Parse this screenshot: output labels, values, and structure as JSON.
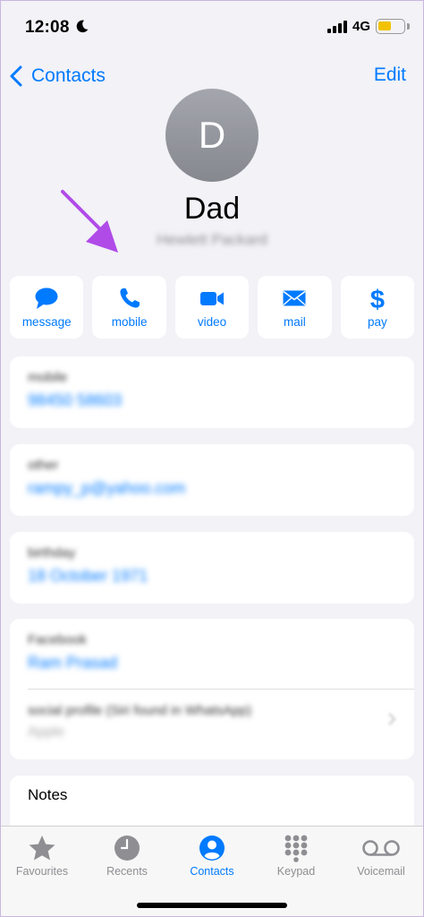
{
  "status_bar": {
    "time": "12:08",
    "network": "4G",
    "battery_level": 0.55
  },
  "nav": {
    "back_label": "Contacts",
    "edit_label": "Edit"
  },
  "contact": {
    "initial": "D",
    "name": "Dad",
    "company": "Hewlett Packard"
  },
  "actions": [
    {
      "label": "message",
      "icon": "message-bubble-icon"
    },
    {
      "label": "mobile",
      "icon": "phone-icon"
    },
    {
      "label": "video",
      "icon": "video-camera-icon"
    },
    {
      "label": "mail",
      "icon": "envelope-icon"
    },
    {
      "label": "pay",
      "icon": "dollar-icon"
    }
  ],
  "fields": {
    "mobile": {
      "label": "mobile",
      "value": "98450 58603"
    },
    "other": {
      "label": "other",
      "value": "rampy_p@yahoo.com"
    },
    "birthday": {
      "label": "birthday",
      "value": "18 October 1971"
    },
    "facebook": {
      "label": "Facebook",
      "value": "Ram Prasad"
    },
    "social": {
      "label": "social profile (Siri found in WhatsApp)",
      "value": "Apple"
    }
  },
  "notes": {
    "label": "Notes"
  },
  "tabs": [
    {
      "label": "Favourites",
      "icon": "star-icon",
      "active": false
    },
    {
      "label": "Recents",
      "icon": "clock-icon",
      "active": false
    },
    {
      "label": "Contacts",
      "icon": "person-circle-icon",
      "active": true
    },
    {
      "label": "Keypad",
      "icon": "keypad-icon",
      "active": false
    },
    {
      "label": "Voicemail",
      "icon": "voicemail-icon",
      "active": false
    }
  ],
  "colors": {
    "accent": "#007aff",
    "background": "#f2f2f7",
    "annotation_arrow": "#b04be8",
    "battery": "#f2c200"
  }
}
